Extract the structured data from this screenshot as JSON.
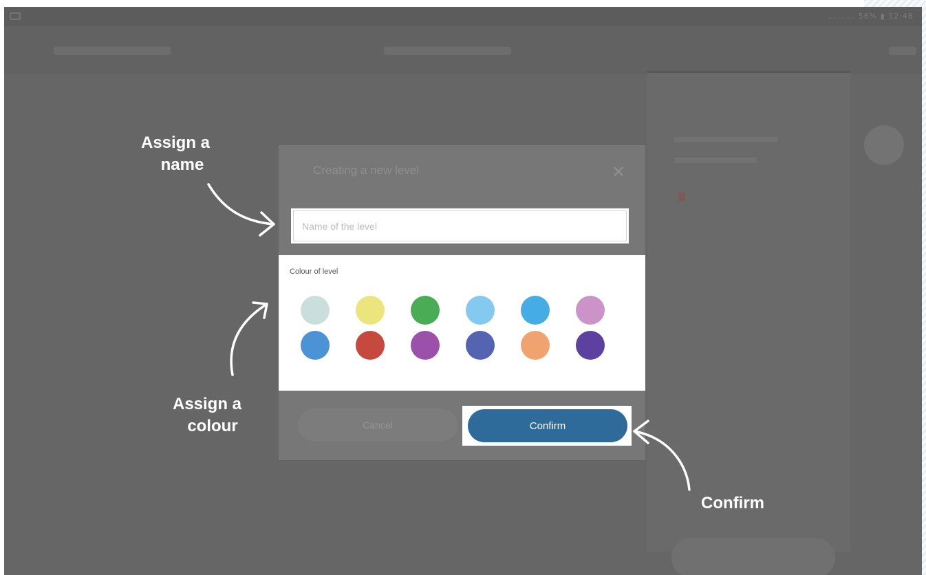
{
  "status_bar": {
    "right_text": "…… … 56% ▮ 12:46"
  },
  "dialog": {
    "title": "Creating a new level",
    "close_symbol": "✕",
    "name_input": {
      "placeholder": "Name of the level",
      "value": ""
    },
    "colour_label": "Colour of level",
    "colours": [
      "#c9dedd",
      "#ece47c",
      "#4aac55",
      "#84caf0",
      "#45ade4",
      "#cc93c8",
      "#4b93d5",
      "#c6493d",
      "#9b51aa",
      "#5563b3",
      "#f0a36f",
      "#5c41a0"
    ],
    "cancel_label": "Cancel",
    "confirm_label": "Confirm"
  },
  "annotations": {
    "name_line1": "Assign a",
    "name_line2": "name",
    "colour_line1": "Assign a",
    "colour_line2": "colour",
    "confirm": "Confirm"
  },
  "icons": {
    "close": "close-icon",
    "status": "status-icons"
  },
  "theme": {
    "overlay": "#666666",
    "accent": "#2e6b9a",
    "annotation_text": "#ffffff"
  }
}
